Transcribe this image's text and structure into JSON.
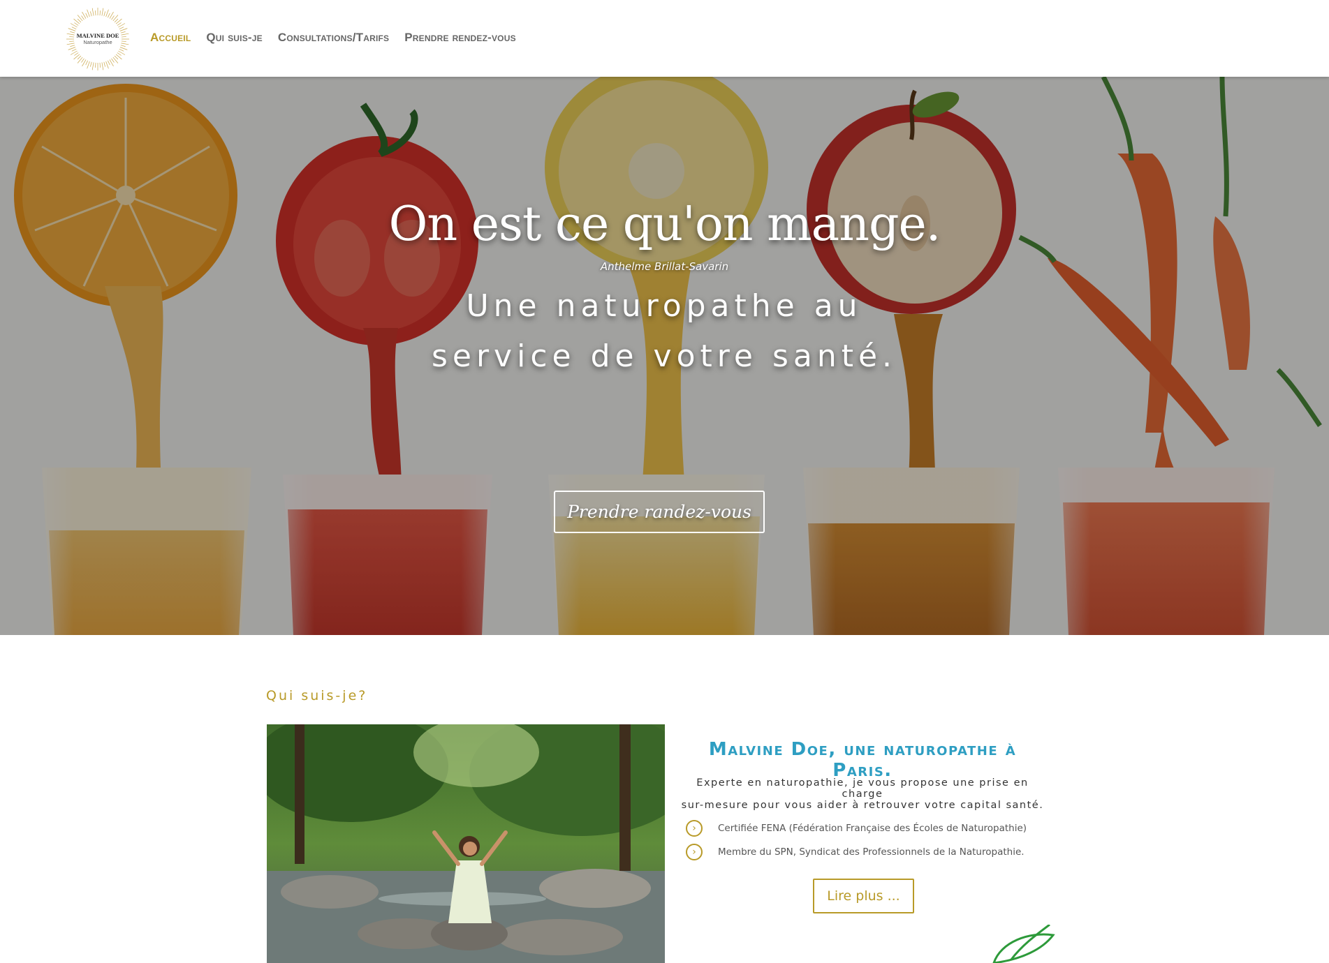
{
  "header": {
    "logo": {
      "name": "MALVINE DOE",
      "subtitle": "Naturopathe"
    },
    "nav": [
      {
        "label": "Accueil",
        "active": true
      },
      {
        "label": "Qui suis-je",
        "active": false
      },
      {
        "label": "Consultations/Tarifs",
        "active": false
      },
      {
        "label": "Prendre rendez-vous",
        "active": false
      }
    ]
  },
  "hero": {
    "quote": "On est ce qu'on mange.",
    "author": "Anthelme Brillat-Savarin",
    "tagline_line1": "Une naturopathe au",
    "tagline_line2": "service de votre santé.",
    "cta_label": "Prendre randez-vous",
    "image_subject": "fruit-and-vegetable-juices"
  },
  "about": {
    "section_label": "Qui suis-je?",
    "title": "Malvine Doe, une naturopathe à Paris.",
    "description_line1": "Experte en naturopathie, je vous propose une prise en charge",
    "description_line2": "sur-mesure pour vous aider à retrouver votre capital santé.",
    "bullets": [
      "Certifiée FENA (Fédération Française des Écoles de Naturopathie)",
      "Membre du SPN, Syndicat des Professionnels de la Naturopathie."
    ],
    "read_more_label": "Lire plus ...",
    "photo_subject": "woman-sitting-on-rock-in-forest-stream"
  },
  "colors": {
    "accent_gold": "#b89a28",
    "title_blue": "#2e9ec2",
    "nav_gray": "#666666"
  }
}
